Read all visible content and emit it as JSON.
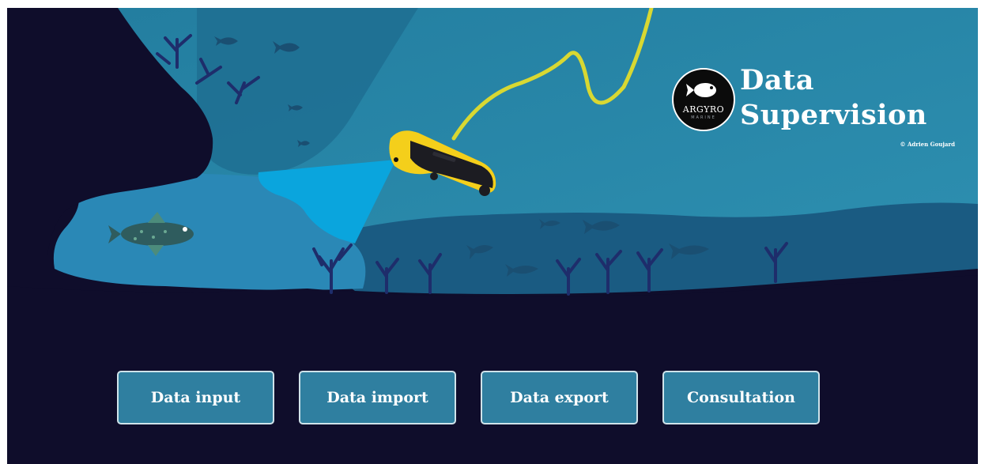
{
  "brand": {
    "logo_name": "ARGYRO",
    "logo_sub": "MARINE",
    "title_line1": "Data",
    "title_line2": "Supervision",
    "credit": "© Adrien Goujard"
  },
  "nav": {
    "buttons": [
      {
        "label": "Data input"
      },
      {
        "label": "Data import"
      },
      {
        "label": "Data export"
      },
      {
        "label": "Consultation"
      }
    ]
  },
  "colors": {
    "night": "#0f0d2b",
    "ocean_light": "#3096b1",
    "ocean_mid": "#1c6a8d",
    "seabed": "#174b70",
    "light_beam": "#0aa5dd",
    "rov_yellow": "#f4cf1b",
    "tether": "#d8d832",
    "coral": "#1e2d6b",
    "button_fill": "#2f7fa0",
    "button_border": "#cfe3ea"
  }
}
